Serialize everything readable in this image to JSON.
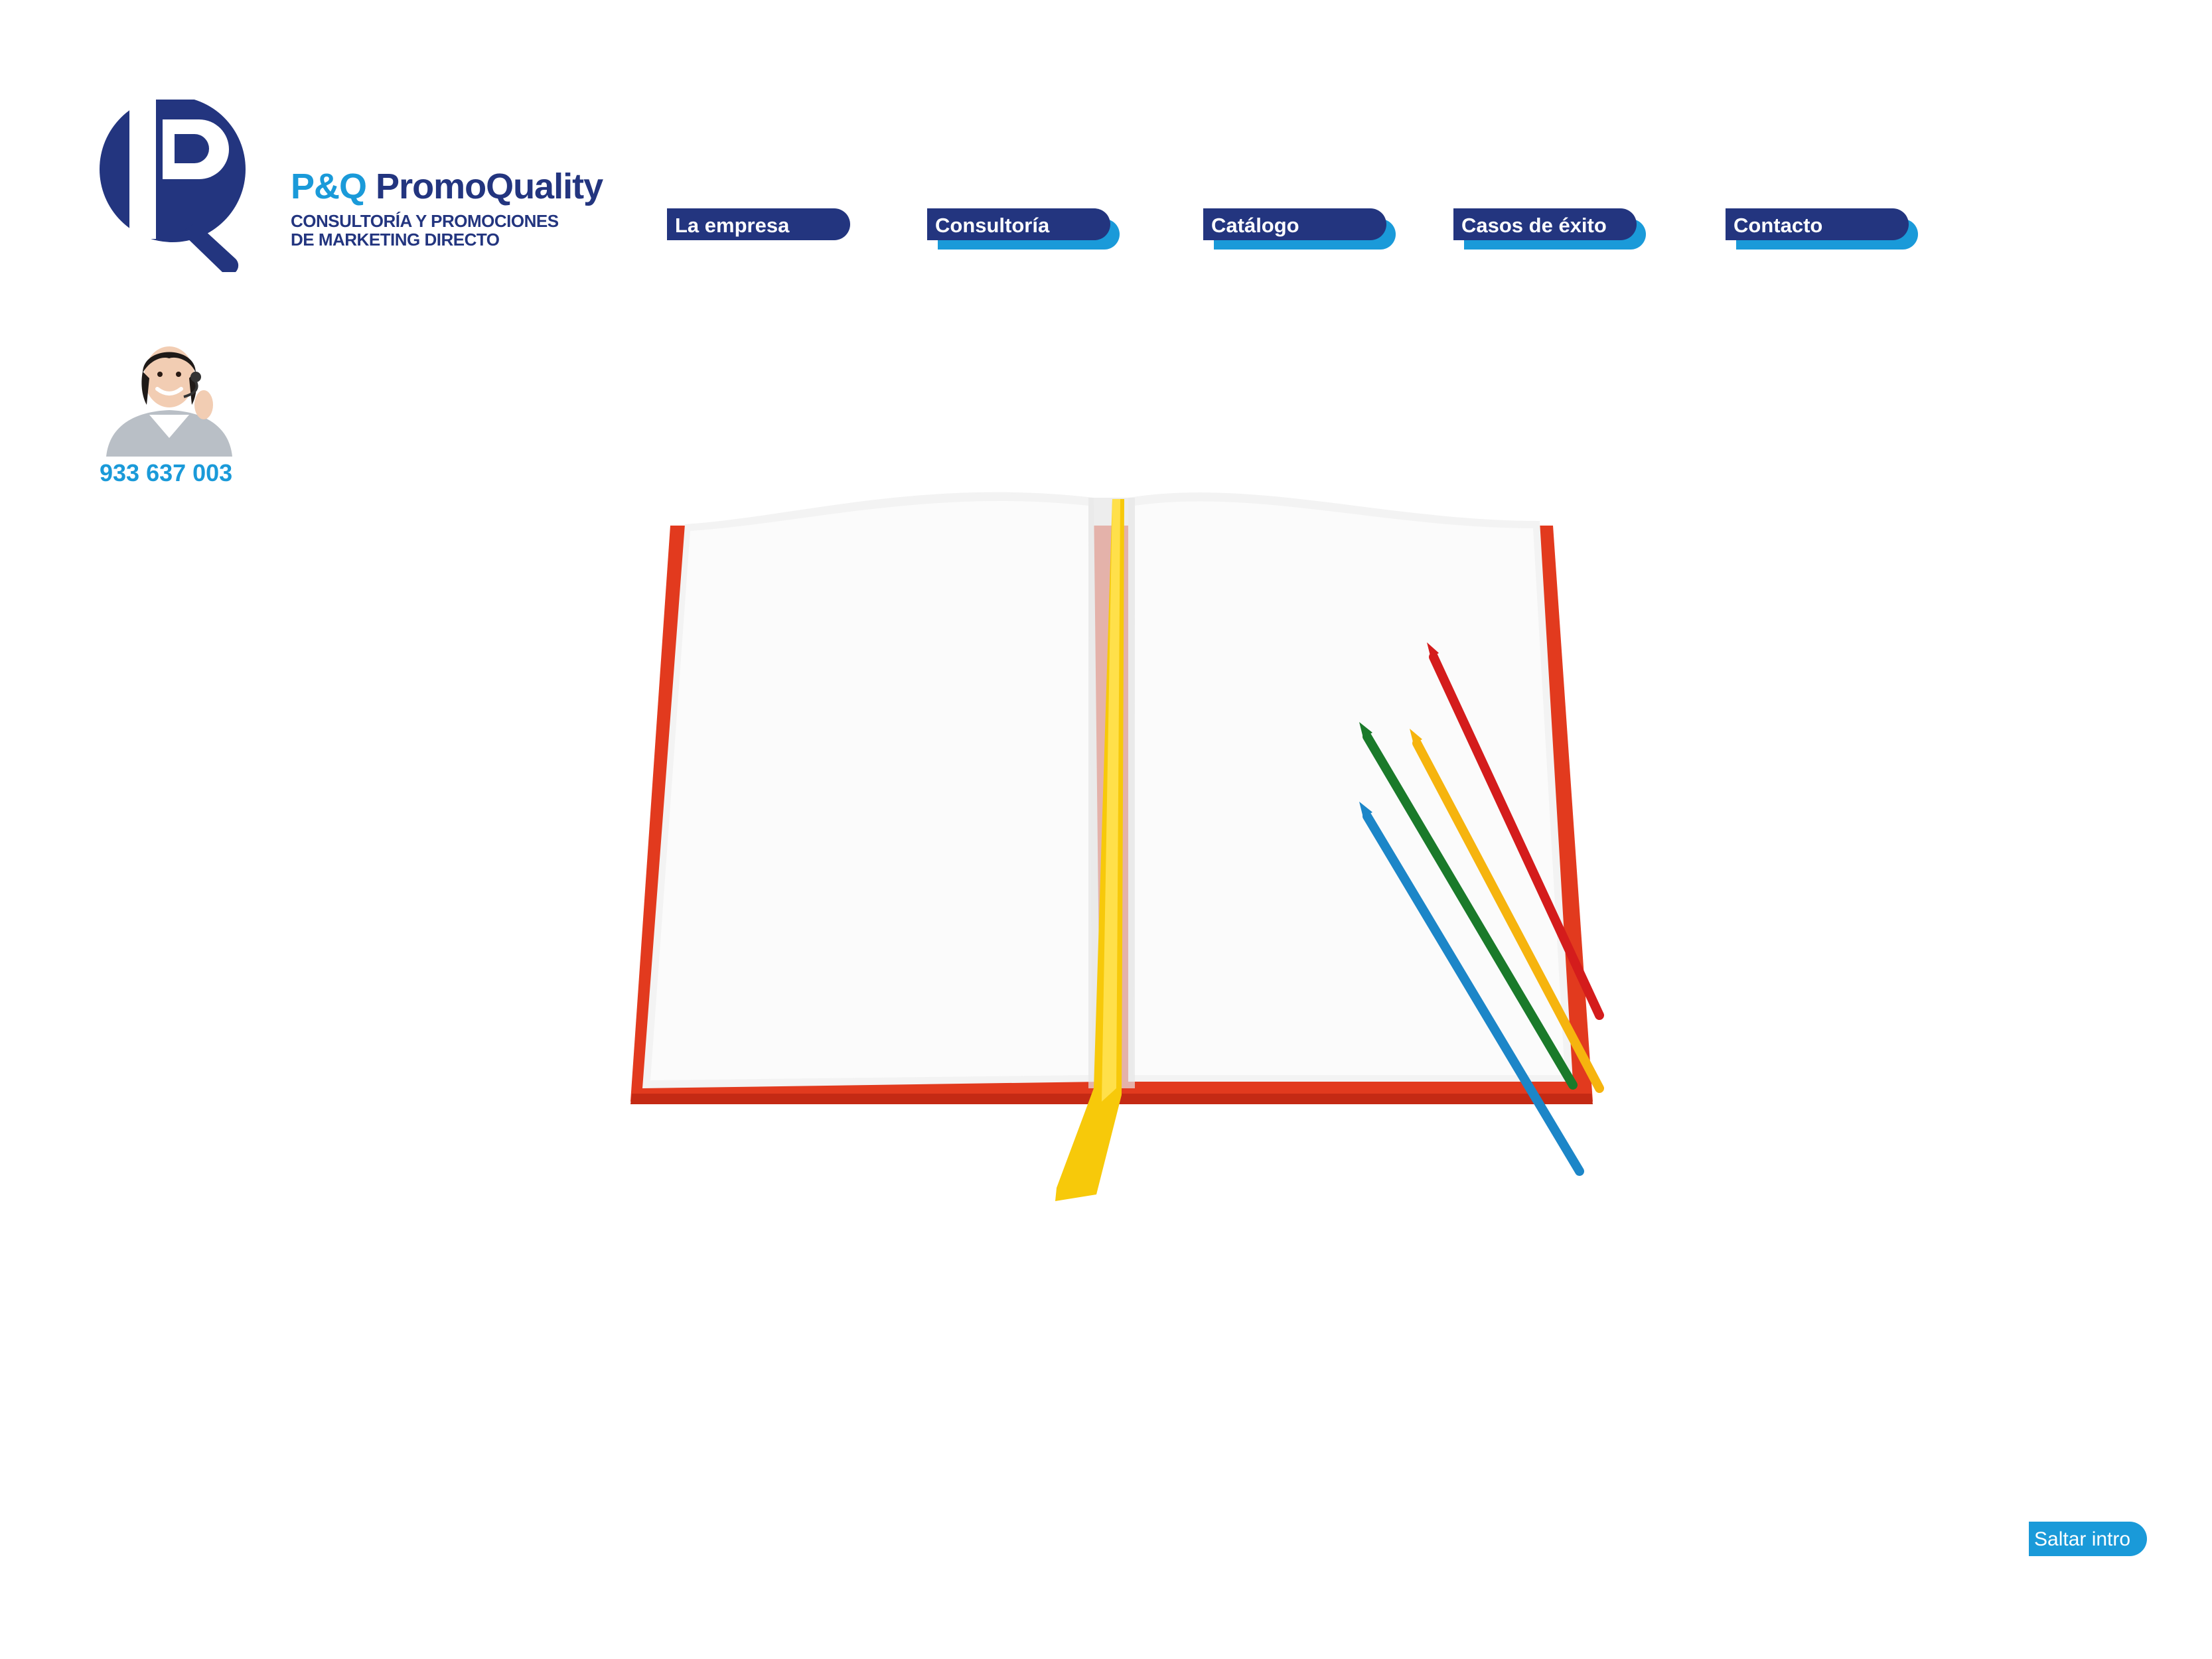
{
  "brand": {
    "name_part1": "P&Q",
    "name_part2": "PromoQuality",
    "tagline_line1": "CONSULTORÍA Y PROMOCIONES",
    "tagline_line2": "DE MARKETING DIRECTO",
    "colors": {
      "primary": "#23357f",
      "accent": "#1a9ad9"
    }
  },
  "nav": {
    "items": [
      {
        "label": "La empresa"
      },
      {
        "label": "Consultoría"
      },
      {
        "label": "Catálogo"
      },
      {
        "label": "Casos de éxito"
      },
      {
        "label": "Contacto"
      }
    ]
  },
  "contact": {
    "phone": "933 637 003",
    "agent_icon": "headset-agent-photo"
  },
  "intro": {
    "illustration": "open-notebook-with-colored-pencils",
    "skip_label": "Saltar intro"
  }
}
